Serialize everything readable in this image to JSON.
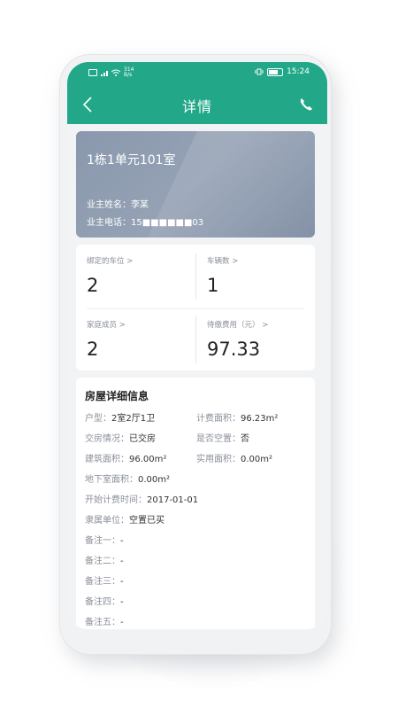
{
  "status_bar": {
    "net_speed_value": "314",
    "net_speed_unit": "B/s",
    "time": "15:24"
  },
  "header": {
    "title": "详情"
  },
  "house_card": {
    "room": "1栋1单元101室",
    "owner_label": "业主姓名：",
    "owner_name": "李某",
    "phone_label": "业主电话：",
    "phone_number": "15■■■■■■03"
  },
  "stats": {
    "bound_parking_label": "绑定的车位 >",
    "bound_parking_value": "2",
    "vehicles_label": "车辆数 >",
    "vehicles_value": "1",
    "family_label": "家庭成员 >",
    "family_value": "2",
    "pending_fee_label": "待缴费用（元） >",
    "pending_fee_value": "97.33"
  },
  "detail": {
    "title": "房屋详细信息",
    "rows": [
      {
        "key": "户型：",
        "value": "2室2厅1卫"
      },
      {
        "key": "计费面积：",
        "value": "96.23m²"
      },
      {
        "key": "交房情况：",
        "value": "已交房"
      },
      {
        "key": "是否空置：",
        "value": "否"
      },
      {
        "key": "建筑面积：",
        "value": "96.00m²"
      },
      {
        "key": "实用面积：",
        "value": "0.00m²"
      },
      {
        "key": "地下室面积：",
        "value": "0.00m²"
      },
      {
        "key": "开始计费时间：",
        "value": "2017-01-01"
      },
      {
        "key": "隶属单位：",
        "value": "空置已买"
      },
      {
        "key": "备注一：",
        "value": "-"
      },
      {
        "key": "备注二：",
        "value": "-"
      },
      {
        "key": "备注三：",
        "value": "-"
      },
      {
        "key": "备注四：",
        "value": "-"
      },
      {
        "key": "备注五：",
        "value": "-"
      }
    ]
  },
  "colors": {
    "accent": "#22a889",
    "card": "#8c99ae"
  }
}
